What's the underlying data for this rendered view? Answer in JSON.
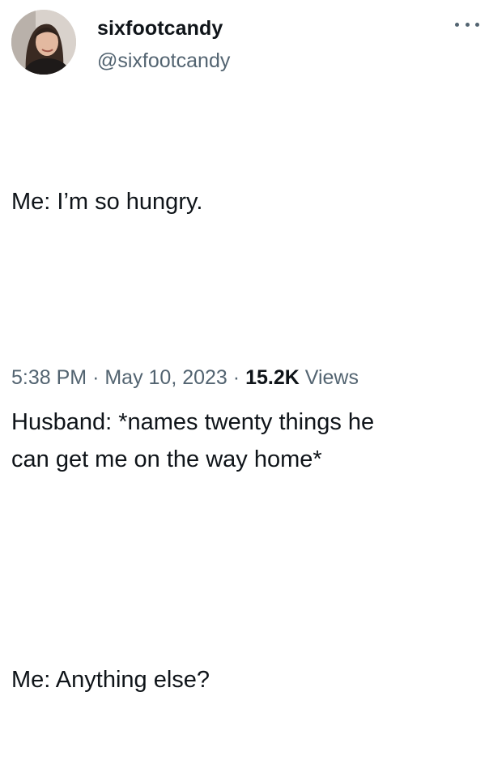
{
  "user": {
    "display_name": "sixfootcandy",
    "handle": "@sixfootcandy"
  },
  "tweet": {
    "lines": [
      "Me: I’m so hungry.",
      "Husband: *names twenty things he\ncan get me on the way home*",
      "Me: Anything else?"
    ]
  },
  "meta": {
    "time": "5:38 PM",
    "sep1": "·",
    "date": "May 10, 2023",
    "sep2": "·",
    "views_count": "15.2K",
    "views_label": "Views"
  },
  "icons": {
    "more": "more-dots-icon"
  },
  "colors": {
    "text": "#0f1419",
    "secondary": "#536471"
  }
}
